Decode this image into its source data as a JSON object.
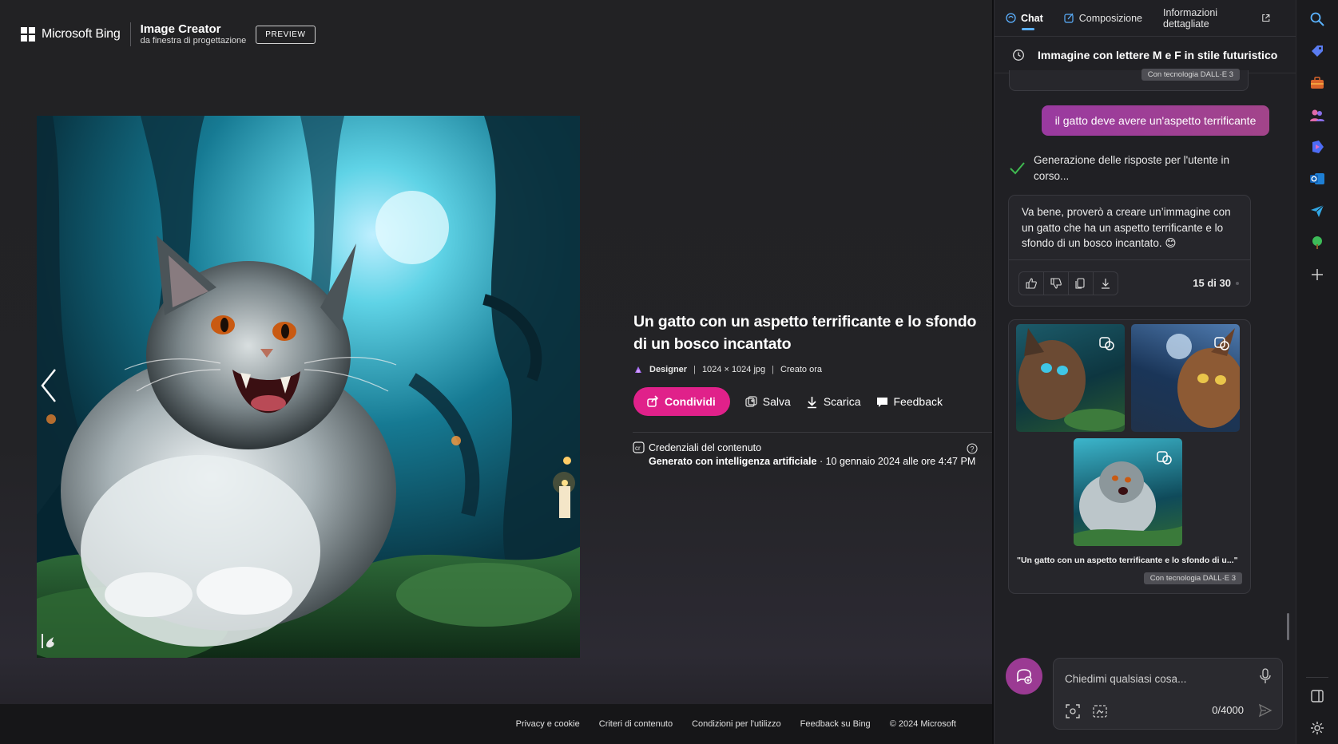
{
  "header": {
    "brand": "Microsoft Bing",
    "product_title": "Image Creator",
    "product_subtitle": "da finestra di progettazione",
    "preview_label": "PREVIEW"
  },
  "image": {
    "title": "Un gatto con un aspetto terrificante e lo sfondo di un bosco incantato",
    "source": "Designer",
    "dimensions": "1024 × 1024 jpg",
    "created": "Creato ora"
  },
  "actions": {
    "share": "Condividi",
    "save": "Salva",
    "download": "Scarica",
    "feedback": "Feedback"
  },
  "credentials": {
    "label": "Credenziali del contenuto",
    "generated": "Generato con intelligenza artificiale",
    "date": " · 10 gennaio 2024 alle ore 4:47 PM"
  },
  "footer": {
    "links": [
      "Privacy e cookie",
      "Criteri di contenuto",
      "Condizioni per l'utilizzo",
      "Feedback su Bing"
    ],
    "copyright": "© 2024 Microsoft"
  },
  "sidebar": {
    "tabs": [
      {
        "label": "Chat"
      },
      {
        "label": "Composizione"
      },
      {
        "label": "Informazioni dettagliate"
      }
    ],
    "conversation_title": "Immagine con lettere M e F in stile futuristico",
    "dalle_tag": "Con tecnologia DALL·E 3",
    "user_message": "il gatto deve avere un'aspetto terrificante",
    "status": "Generazione delle risposte per l'utente in corso...",
    "answer": "Va bene, proverò a creare un’immagine con un gatto che ha un aspetto terrificante e lo sfondo di un bosco incantato. 😊",
    "counter": "15 di 30",
    "gallery_caption": "\"Un gatto con un aspetto terrificante e lo sfondo di u...\"",
    "composer_placeholder": "Chiedimi qualsiasi cosa...",
    "char_count": "0/4000"
  },
  "colors": {
    "accent_pink": "#e0218a",
    "user_bubble": "#9a3aa0",
    "tab_underline": "#5bb0ff",
    "status_check": "#3fb950"
  },
  "icons": {
    "edge_toolbar": [
      "search-icon",
      "tag-icon",
      "briefcase-icon",
      "people-icon",
      "copilot-icon",
      "outlook-icon",
      "send-icon",
      "tree-icon",
      "plus-icon",
      "panel-icon",
      "settings-icon"
    ]
  }
}
